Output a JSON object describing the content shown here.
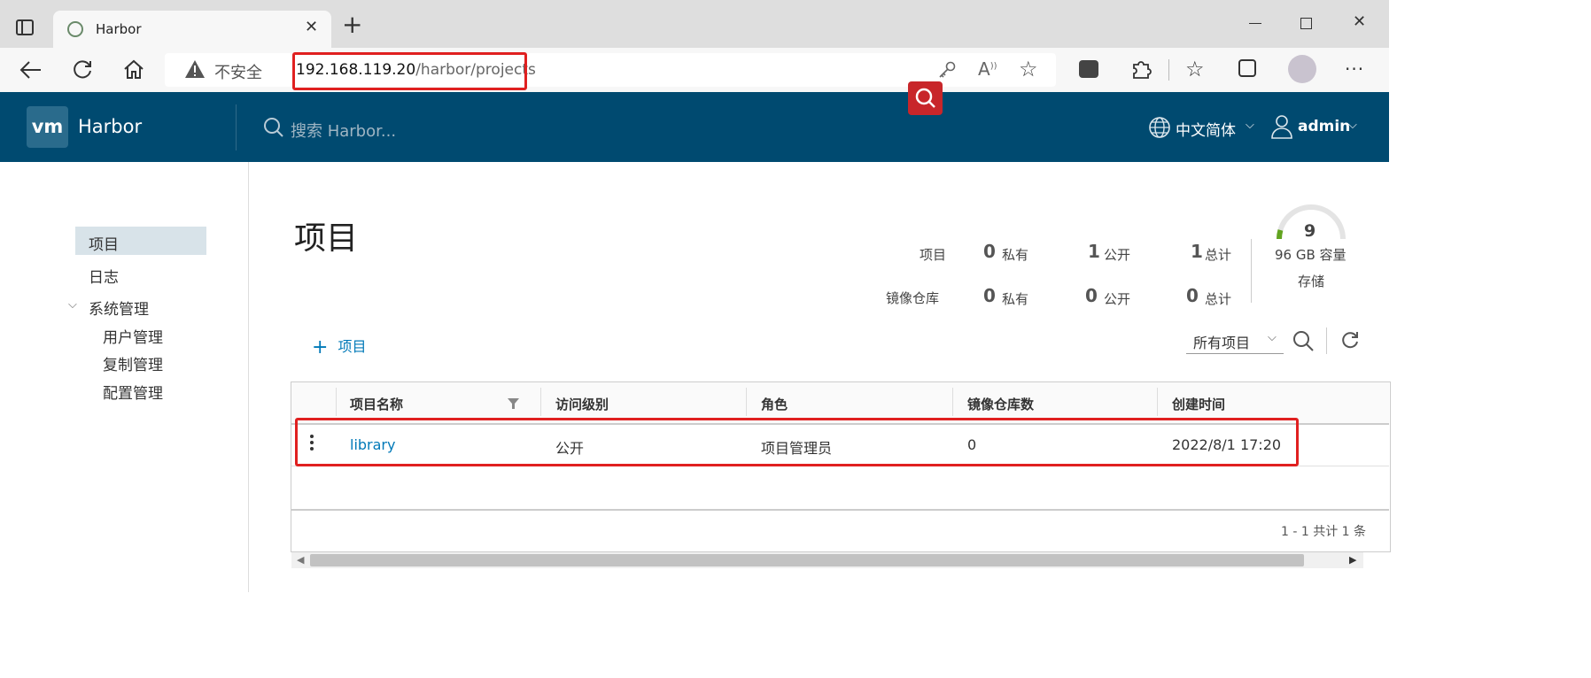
{
  "browser": {
    "tab_title": "Harbor",
    "security_label": "不安全",
    "url_host": "192.168.119.20",
    "url_path": "/harbor/projects"
  },
  "app": {
    "logo": "vm",
    "brand": "Harbor",
    "search_placeholder": "搜索 Harbor...",
    "language": "中文简体",
    "user": "admin"
  },
  "sidebar": {
    "items": [
      "项目",
      "日志",
      "系统管理"
    ],
    "sub_items": [
      "用户管理",
      "复制管理",
      "配置管理"
    ]
  },
  "main": {
    "title": "项目",
    "stats": {
      "projects_label": "项目",
      "repos_label": "镜像仓库",
      "private_label": "私有",
      "public_label": "公开",
      "total_label": "总计",
      "projects_private": "0",
      "projects_public": "1",
      "projects_total": "1",
      "repos_private": "0",
      "repos_public": "0",
      "repos_total": "0"
    },
    "storage": {
      "value": "9",
      "capacity": "96 GB 容量",
      "label": "存储",
      "used_fraction": 0.09
    },
    "new_project_label": "项目",
    "filter_select": "所有项目",
    "columns": [
      "项目名称",
      "访问级别",
      "角色",
      "镜像仓库数",
      "创建时间"
    ],
    "rows": [
      {
        "name": "library",
        "access": "公开",
        "role": "项目管理员",
        "repos": "0",
        "created": "2022/8/1 17:20"
      }
    ],
    "pagination": "1 - 1 共计 1 条"
  }
}
